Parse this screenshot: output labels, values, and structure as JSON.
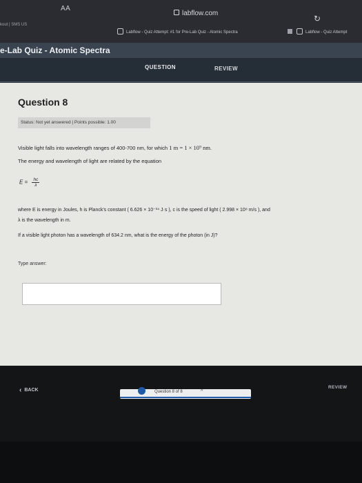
{
  "browser": {
    "aa_label": "AA",
    "url": "labflow.com",
    "left_meta": "kout | SMS US",
    "tabs": [
      {
        "label": "Labflow - Quiz Attempt: #1 for Pre-Lab Quiz - Atomic Spectra"
      },
      {
        "label": "Labflow - Quiz Attempt"
      }
    ]
  },
  "header": {
    "quiz_title": "e-Lab Quiz - Atomic Spectra",
    "tab_question": "QUESTION",
    "tab_review": "REVIEW"
  },
  "question": {
    "number_label": "Question 8",
    "status": "Status: Not yet answered | Points possible: 1.00",
    "p1_text": "Visible light falls into wavelength ranges of 400-700 nm, for which",
    "p1_math": " 1 m = 1 × 10⁹ nm",
    "p1_end": ".",
    "p2": "The energy and wavelength of light are related by the equation",
    "formula_lhs": "E =",
    "formula_num": "hc",
    "formula_den": "λ",
    "p3": "where  E  is energy in Joules,  h  is Planck's constant ( 6.626 × 10⁻³⁴ J·s ),  c  is the speed of light ( 2.998 × 10⁸ m/s ), and",
    "p4": "λ  is the wavelength in m.",
    "p5": "If a visible light photon has a wavelength of 634.2 nm, what is the energy of the photon (in J)?",
    "type_label": "Type answer:",
    "answer_value": ""
  },
  "footer": {
    "back_label": "BACK",
    "progress_label": "Question 8 of 8",
    "review_label": "REVIEW",
    "progress_fraction": 1.0
  }
}
